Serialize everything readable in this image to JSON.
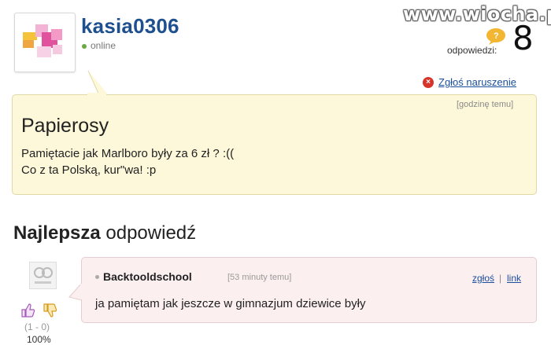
{
  "header": {
    "username": "kasia0306",
    "status": "online",
    "replies_label": "odpowiedzi:",
    "replies_count": "8",
    "watermark": "www.wiocha.pl"
  },
  "question": {
    "report_label": "Zgłoś naruszenie",
    "time": "[godzinę temu]",
    "title": "Papierosy",
    "line1": "Pamiętacie jak Marlboro były za 6 zł ? :((",
    "line2": "Co z ta Polską, kur\"wa! :p"
  },
  "best_answer": {
    "heading_bold": "Najlepsza",
    "heading_rest": " odpowiedź",
    "user": "Backtooldschool",
    "time": "[53 minuty temu]",
    "report_label": "zgłoś",
    "separator": "|",
    "link_label": "link",
    "text": "ja pamiętam jak jeszcze w gimnazjum dziewice były",
    "votes": "(1 - 0)",
    "percent": "100%"
  },
  "colors": {
    "username": "#1e4f8e",
    "question_bg": "#fdf8d9",
    "answer_bg": "#fbeff0",
    "link": "#1a4f9b"
  }
}
